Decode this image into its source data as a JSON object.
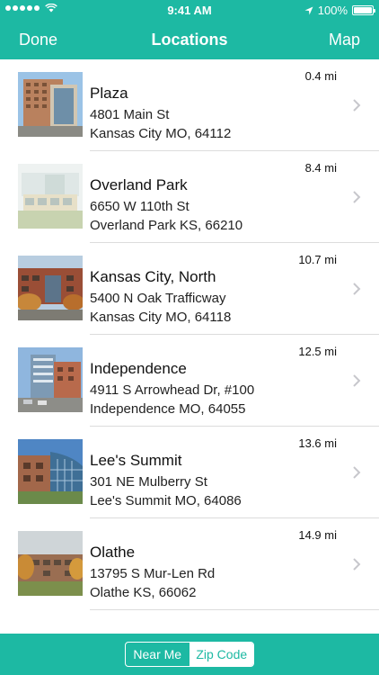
{
  "status_bar": {
    "time": "9:41 AM",
    "battery": "100%"
  },
  "nav": {
    "left": "Done",
    "title": "Locations",
    "right": "Map"
  },
  "locations": [
    {
      "name": "Plaza",
      "address1": "4801 Main St",
      "address2": "Kansas City MO, 64112",
      "distance": "0.4 mi"
    },
    {
      "name": "Overland Park",
      "address1": "6650 W 110th St",
      "address2": "Overland Park KS, 66210",
      "distance": "8.4 mi"
    },
    {
      "name": "Kansas City, North",
      "address1": "5400 N Oak Trafficway",
      "address2": "Kansas City MO, 64118",
      "distance": "10.7 mi"
    },
    {
      "name": "Independence",
      "address1": "4911 S Arrowhead Dr, #100",
      "address2": "Independence MO, 64055",
      "distance": "12.5 mi"
    },
    {
      "name": "Lee's Summit",
      "address1": "301 NE Mulberry St",
      "address2": "Lee's Summit MO, 64086",
      "distance": "13.6 mi"
    },
    {
      "name": "Olathe",
      "address1": "13795 S Mur-Len Rd",
      "address2": "Olathe KS, 66062",
      "distance": "14.9 mi"
    }
  ],
  "segment": {
    "near_me": "Near Me",
    "zip_code": "Zip Code",
    "selected": "zip_code"
  },
  "colors": {
    "accent": "#1db9a3"
  }
}
